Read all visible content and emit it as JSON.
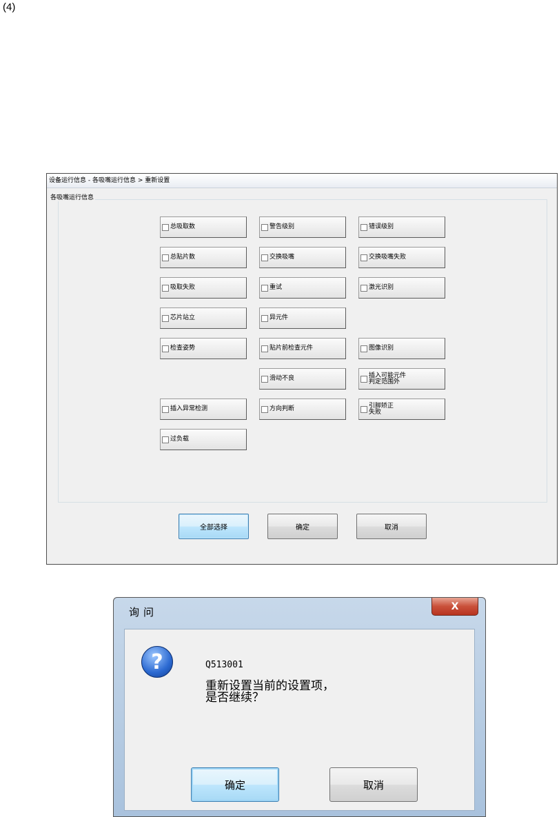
{
  "page_label": "(4)",
  "main_window": {
    "title": "设备运行信息 - 各吸嘴运行信息 > 重新设置",
    "group_label": "各吸嘴运行信息",
    "checkboxes": [
      {
        "label": "总吸取数"
      },
      {
        "label": "警告级别"
      },
      {
        "label": "错误级别"
      },
      {
        "label": "总贴片数"
      },
      {
        "label": "交换吸嘴"
      },
      {
        "label": "交换吸嘴失败"
      },
      {
        "label": "吸取失败"
      },
      {
        "label": "重试"
      },
      {
        "label": "激光识别"
      },
      {
        "label": "芯片站立"
      },
      {
        "label": "异元件"
      },
      {
        "label": "检查姿势"
      },
      {
        "label": "贴片前检查元件"
      },
      {
        "label": "图像识别"
      },
      {
        "label": "滑动不良"
      },
      {
        "label": "插入可能元件\n判定范围外"
      },
      {
        "label": "插入异常检测"
      },
      {
        "label": "方向判断"
      },
      {
        "label": "引脚矫正\n失败"
      },
      {
        "label": "过负载"
      }
    ],
    "buttons": {
      "select_all": "全部选择",
      "ok": "确定",
      "cancel": "取消"
    }
  },
  "dialog": {
    "title": "询问",
    "close_symbol": "X",
    "icon": "question-icon",
    "code": "Q513001",
    "message": "重新设置当前的设置项，\n是否继续？",
    "buttons": {
      "ok": "确定",
      "cancel": "取消"
    }
  }
}
